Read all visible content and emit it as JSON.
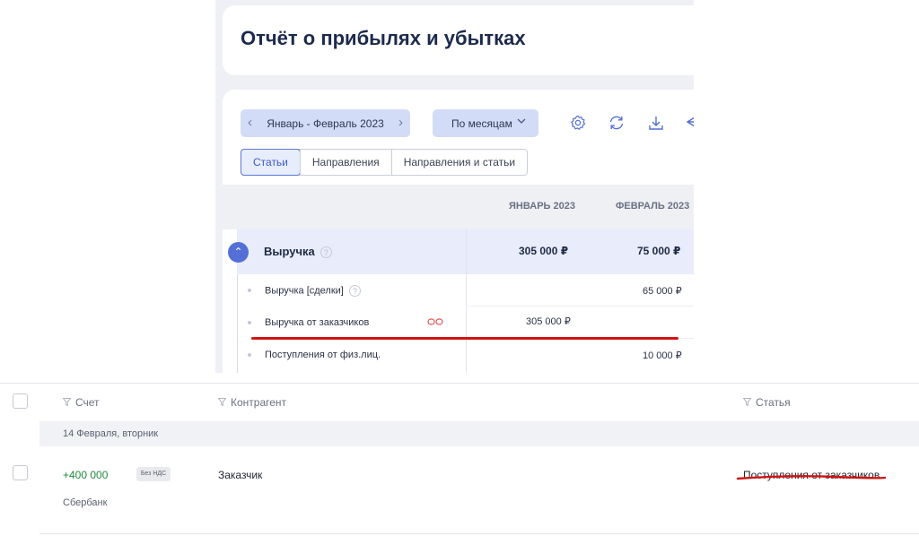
{
  "report": {
    "title": "Отчёт о прибылях и убытках",
    "period": "Январь - Февраль 2023",
    "grouping": "По месяцам",
    "tabs": [
      "Статьи",
      "Направления",
      "Направления и статьи"
    ],
    "columns": [
      "ЯНВАРЬ 2023",
      "ФЕВРАЛЬ 2023"
    ],
    "revenue": {
      "label": "Выручка",
      "jan": "305 000 ₽",
      "feb": "75 000 ₽"
    },
    "rows": [
      {
        "label": "Выручка [сделки]",
        "jan": "",
        "feb": "65 000 ₽"
      },
      {
        "label": "Выручка от заказчиков",
        "jan": "305 000 ₽",
        "feb": ""
      },
      {
        "label": "Поступления от физ.лиц.",
        "jan": "",
        "feb": "10 000 ₽"
      }
    ],
    "icons": [
      "settings-icon",
      "refresh-icon",
      "download-icon",
      "share-icon",
      "link-icon"
    ]
  },
  "operations": {
    "headers": {
      "account": "Счет",
      "counterparty": "Контрагент",
      "category": "Статья"
    },
    "date_group": "14 Февраля, вторник",
    "item": {
      "amount": "+400 000",
      "vat": "Без НДС",
      "bank": "Сбербанк",
      "counterparty": "Заказчик",
      "category": "Поступления от заказчиков"
    }
  },
  "colors": {
    "accent": "#5470d6",
    "positive": "#1c8a3c",
    "highlight": "#d21313"
  }
}
